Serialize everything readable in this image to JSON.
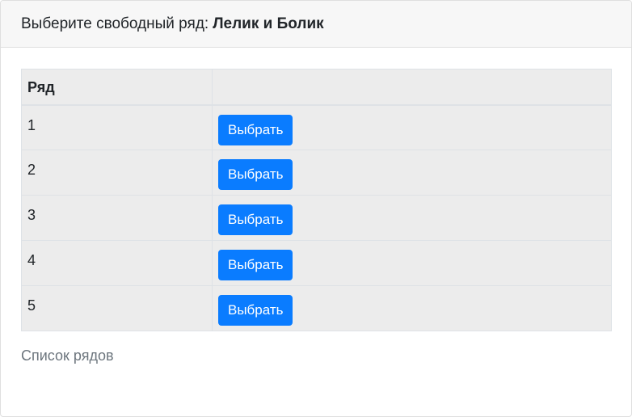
{
  "header": {
    "prefix": "Выберите свободный ряд:",
    "group_name": "Лелик и Болик"
  },
  "table": {
    "columns": [
      "Ряд",
      ""
    ],
    "rows": [
      {
        "number": "1",
        "button": "Выбрать"
      },
      {
        "number": "2",
        "button": "Выбрать"
      },
      {
        "number": "3",
        "button": "Выбрать"
      },
      {
        "number": "4",
        "button": "Выбрать"
      },
      {
        "number": "5",
        "button": "Выбрать"
      }
    ]
  },
  "footer": {
    "link": "Список рядов"
  },
  "colors": {
    "button_bg": "#0a7cff",
    "table_bg": "#ececec",
    "header_bg": "#f7f7f7",
    "link": "#6c757d"
  }
}
